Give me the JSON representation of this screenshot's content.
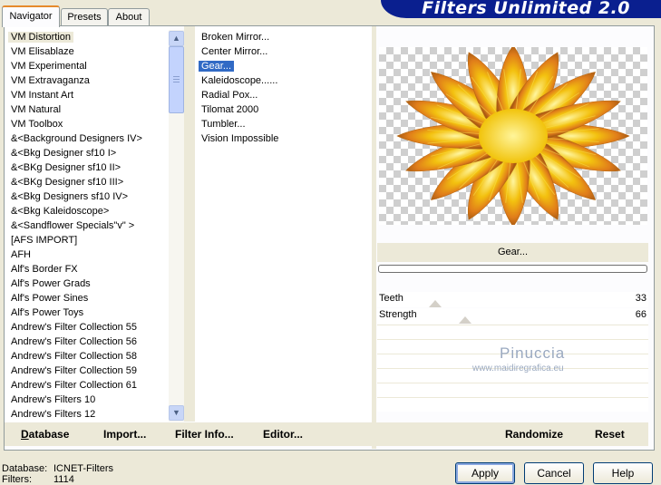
{
  "tabs": [
    "Navigator",
    "Presets",
    "About"
  ],
  "banner": "Filters Unlimited 2.0",
  "categories": [
    "VM Distortion",
    "VM Elisablaze",
    "VM Experimental",
    "VM Extravaganza",
    "VM Instant Art",
    "VM Natural",
    "VM Toolbox",
    "&<Background Designers IV>",
    "&<Bkg Designer sf10 I>",
    "&<BKg Designer sf10 II>",
    "&<BKg Designer sf10 III>",
    "&<Bkg Designers sf10 IV>",
    "&<Bkg Kaleidoscope>",
    "&<Sandflower Specials\"v\" >",
    "[AFS IMPORT]",
    "AFH",
    "Alf's Border FX",
    "Alf's Power Grads",
    "Alf's Power Sines",
    "Alf's Power Toys",
    "Andrew's Filter Collection 55",
    "Andrew's Filter Collection 56",
    "Andrew's Filter Collection 58",
    "Andrew's Filter Collection 59",
    "Andrew's Filter Collection 61",
    "Andrew's Filters 10",
    "Andrew's Filters 12"
  ],
  "selected_category": "VM Distortion",
  "filters": [
    "Broken Mirror...",
    "Center Mirror...",
    "Gear...",
    "Kaleidoscope......",
    "Radial Pox...",
    "Tilomat 2000",
    "Tumbler...",
    "Vision Impossible"
  ],
  "selected_filter": "Gear...",
  "filter_name": "Gear...",
  "sliders": [
    {
      "label": "Teeth",
      "value": "33",
      "level": 33
    },
    {
      "label": "Strength",
      "value": "66",
      "level": 66
    }
  ],
  "left_actions": {
    "database": "Database",
    "import": "Import...",
    "filter_info": "Filter Info...",
    "editor": "Editor..."
  },
  "right_actions": {
    "randomize": "Randomize",
    "reset": "Reset"
  },
  "watermark": {
    "name": "Pinuccia",
    "url": "www.maidiregrafica.eu"
  },
  "status": {
    "database_label": "Database:",
    "database_value": "ICNET-Filters",
    "filters_label": "Filters:",
    "filters_value": "1114"
  },
  "buttons": {
    "apply": "Apply",
    "cancel": "Cancel",
    "help": "Help"
  },
  "colors": {
    "selection": "#316ac5",
    "banner": "#0a1f8f",
    "tab_accent": "#e68b2c"
  },
  "icons": {
    "scroll_up": "chevron-up-icon",
    "scroll_down": "chevron-down-icon"
  }
}
